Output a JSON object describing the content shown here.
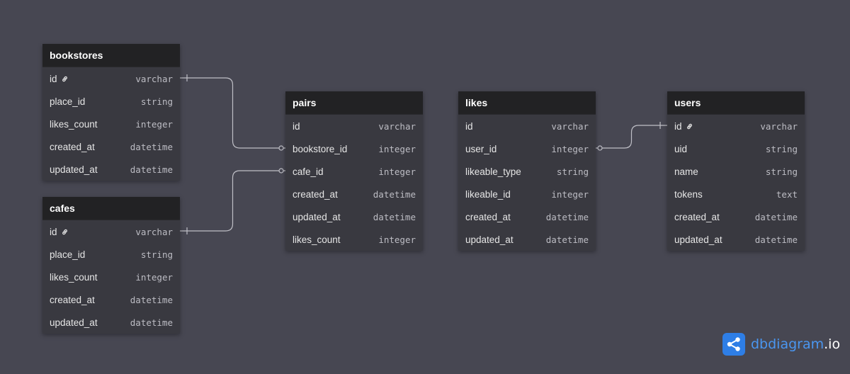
{
  "tables": [
    {
      "id": "bookstores",
      "name": "bookstores",
      "columns": [
        {
          "name": "id",
          "type": "varchar",
          "pk": true
        },
        {
          "name": "place_id",
          "type": "string"
        },
        {
          "name": "likes_count",
          "type": "integer"
        },
        {
          "name": "created_at",
          "type": "datetime"
        },
        {
          "name": "updated_at",
          "type": "datetime"
        }
      ]
    },
    {
      "id": "cafes",
      "name": "cafes",
      "columns": [
        {
          "name": "id",
          "type": "varchar",
          "pk": true
        },
        {
          "name": "place_id",
          "type": "string"
        },
        {
          "name": "likes_count",
          "type": "integer"
        },
        {
          "name": "created_at",
          "type": "datetime"
        },
        {
          "name": "updated_at",
          "type": "datetime"
        }
      ]
    },
    {
      "id": "pairs",
      "name": "pairs",
      "columns": [
        {
          "name": "id",
          "type": "varchar"
        },
        {
          "name": "bookstore_id",
          "type": "integer"
        },
        {
          "name": "cafe_id",
          "type": "integer"
        },
        {
          "name": "created_at",
          "type": "datetime"
        },
        {
          "name": "updated_at",
          "type": "datetime"
        },
        {
          "name": "likes_count",
          "type": "integer"
        }
      ]
    },
    {
      "id": "likes",
      "name": "likes",
      "columns": [
        {
          "name": "id",
          "type": "varchar"
        },
        {
          "name": "user_id",
          "type": "integer"
        },
        {
          "name": "likeable_type",
          "type": "string"
        },
        {
          "name": "likeable_id",
          "type": "integer"
        },
        {
          "name": "created_at",
          "type": "datetime"
        },
        {
          "name": "updated_at",
          "type": "datetime"
        }
      ]
    },
    {
      "id": "users",
      "name": "users",
      "columns": [
        {
          "name": "id",
          "type": "varchar",
          "pk": true
        },
        {
          "name": "uid",
          "type": "string"
        },
        {
          "name": "name",
          "type": "string"
        },
        {
          "name": "tokens",
          "type": "text"
        },
        {
          "name": "created_at",
          "type": "datetime"
        },
        {
          "name": "updated_at",
          "type": "datetime"
        }
      ]
    }
  ],
  "relations": [
    {
      "from_table": "bookstores",
      "from_column": "id",
      "from_end": "one",
      "to_table": "pairs",
      "to_column": "bookstore_id",
      "to_end": "many"
    },
    {
      "from_table": "cafes",
      "from_column": "id",
      "from_end": "one",
      "to_table": "pairs",
      "to_column": "cafe_id",
      "to_end": "many"
    },
    {
      "from_table": "likes",
      "from_column": "user_id",
      "from_end": "many",
      "to_table": "users",
      "to_column": "id",
      "to_end": "one"
    }
  ],
  "brand": {
    "name": "dbdiagram",
    "tld": ".io",
    "icon": "share-icon"
  },
  "colors": {
    "background": "#474752",
    "table_header": "#222224",
    "table_body": "#393940",
    "connector": "#bfbfc6",
    "brand": "#2e7ee6"
  }
}
